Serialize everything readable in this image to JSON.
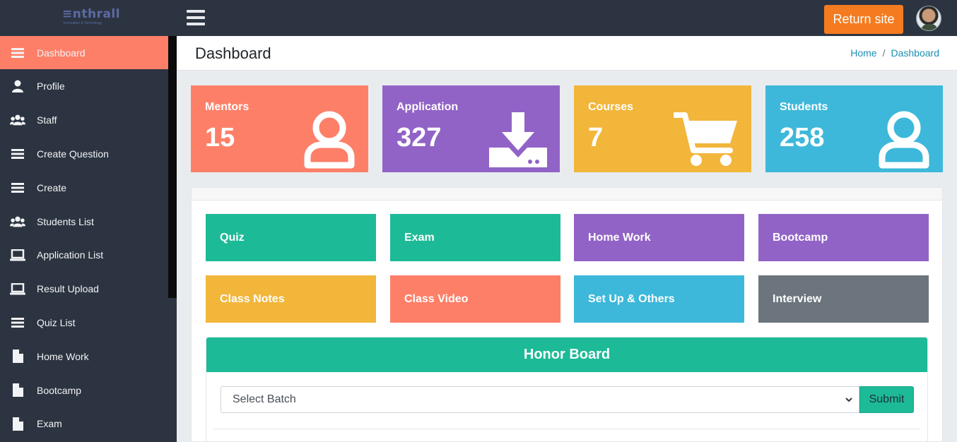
{
  "brand": {
    "name": "nthrall",
    "tagline": "Innovation & Technology"
  },
  "topbar": {
    "return_label": "Return site"
  },
  "sidebar": {
    "items": [
      {
        "label": "Dashboard",
        "icon": "bars-icon",
        "active": true
      },
      {
        "label": "Profile",
        "icon": "user-icon"
      },
      {
        "label": "Staff",
        "icon": "users-icon"
      },
      {
        "label": "Create Question",
        "icon": "bars-icon"
      },
      {
        "label": "Create",
        "icon": "bars-icon"
      },
      {
        "label": "Students List",
        "icon": "users-icon"
      },
      {
        "label": "Application List",
        "icon": "laptop-icon"
      },
      {
        "label": "Result Upload",
        "icon": "laptop-icon"
      },
      {
        "label": "Quiz List",
        "icon": "bars-icon"
      },
      {
        "label": "Home Work",
        "icon": "file-icon"
      },
      {
        "label": "Bootcamp",
        "icon": "file-icon"
      },
      {
        "label": "Exam",
        "icon": "file-icon"
      }
    ]
  },
  "header": {
    "title": "Dashboard",
    "breadcrumb": [
      "Home",
      "Dashboard"
    ]
  },
  "stats": [
    {
      "title": "Mentors",
      "value": "15",
      "color": "#fe7f68",
      "icon": "user-outline-icon"
    },
    {
      "title": "Application",
      "value": "327",
      "color": "#9163c6",
      "icon": "download-icon"
    },
    {
      "title": "Courses",
      "value": "7",
      "color": "#f2b63b",
      "icon": "cart-icon"
    },
    {
      "title": "Students",
      "value": "258",
      "color": "#3db8da",
      "icon": "user-outline-icon"
    }
  ],
  "tiles": [
    {
      "label": "Quiz",
      "color": "#1dba97"
    },
    {
      "label": "Exam",
      "color": "#1dba97"
    },
    {
      "label": "Home Work",
      "color": "#9163c6"
    },
    {
      "label": "Bootcamp",
      "color": "#9163c6"
    },
    {
      "label": "Class Notes",
      "color": "#f2b63b"
    },
    {
      "label": "Class Video",
      "color": "#fe7f68"
    },
    {
      "label": "Set Up & Others",
      "color": "#3db8da"
    },
    {
      "label": "Interview",
      "color": "#6c757d"
    }
  ],
  "honor_board": {
    "title": "Honor Board",
    "select_value": "Select Batch",
    "submit_label": "Submit"
  }
}
